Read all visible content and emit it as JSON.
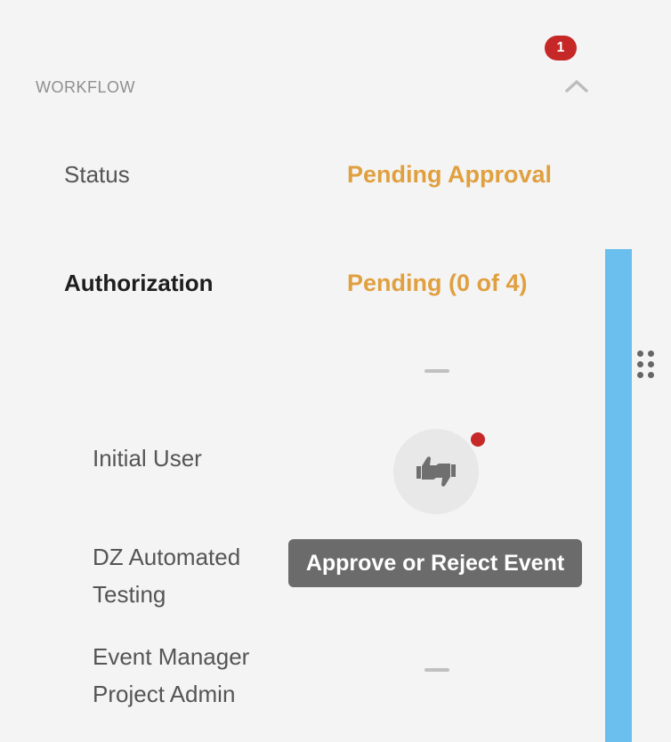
{
  "workflow": {
    "section_title": "WORKFLOW",
    "badge_count": "1",
    "status": {
      "label": "Status",
      "value": "Pending Approval"
    },
    "authorization": {
      "label": "Authorization",
      "value": "Pending (0 of 4)"
    },
    "approvers": [
      {
        "name": "Initial User"
      },
      {
        "name": "DZ Automated Testing"
      },
      {
        "name": "Event Manager Project Admin"
      }
    ],
    "tooltip": "Approve or Reject Event"
  },
  "colors": {
    "pending": "#e0a040",
    "badge": "#c62828",
    "sidebar": "#6bbfee",
    "tooltip_bg": "#6b6b6b"
  },
  "icons": {
    "collapse": "chevron-up-icon",
    "vote": "thumbs-up-down-icon",
    "drag": "drag-handle-icon"
  }
}
